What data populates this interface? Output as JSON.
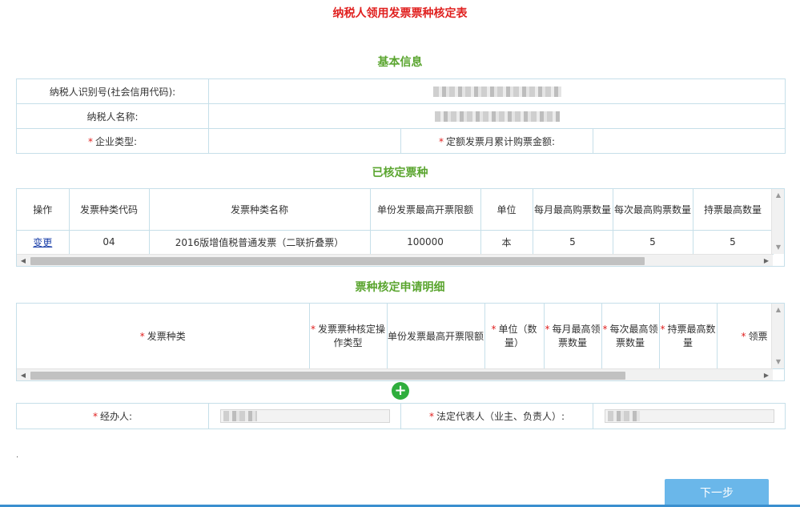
{
  "page_title": "纳税人领用发票票种核定表",
  "basic": {
    "title": "基本信息",
    "taxpayer_id_label": "纳税人识别号(社会信用代码):",
    "taxpayer_name_label": "纳税人名称:",
    "enterprise_type_label": "企业类型:",
    "quota_amount_label": "定额发票月累计购票金额:"
  },
  "approved": {
    "title": "已核定票种",
    "headers": [
      "操作",
      "发票种类代码",
      "发票种类名称",
      "单份发票最高开票限额",
      "单位",
      "每月最高购票数量",
      "每次最高购票数量",
      "持票最高数量"
    ],
    "rows": [
      [
        "变更",
        "04",
        "2016版增值税普通发票（二联折叠票）",
        "100000",
        "本",
        "5",
        "5",
        "5"
      ]
    ]
  },
  "application": {
    "title": "票种核定申请明细",
    "headers": [
      "发票种类",
      "发票票种核定操作类型",
      "单份发票最高开票限额",
      "单位（数量）",
      "每月最高领票数量",
      "每次最高领票数量",
      "持票最高数量",
      "领票"
    ]
  },
  "sign": {
    "agent_label": "经办人:",
    "legal_rep_label": "法定代表人（业主、负责人）:"
  },
  "footer": {
    "dot": ".",
    "next_label": "下一步"
  },
  "colors": {
    "title_red": "#e0201f",
    "section_green": "#5aa52f",
    "button_blue": "#6ab7ea",
    "add_green": "#2fae3d"
  }
}
